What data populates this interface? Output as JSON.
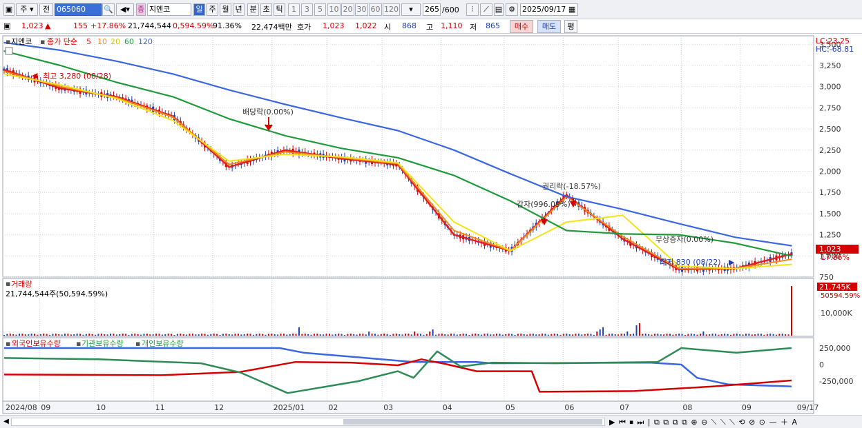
{
  "toolbar": {
    "type_select": "주",
    "prefix_select": "전",
    "code_value": "065060",
    "stock_name": "지엔코",
    "periods": [
      "일",
      "주",
      "월",
      "년",
      "분",
      "초",
      "틱"
    ],
    "active_period": "일",
    "intervals": [
      "1",
      "3",
      "5",
      "10",
      "20",
      "30",
      "60",
      "120"
    ],
    "count": "265",
    "count_total": "/600",
    "date": "2025/09/17"
  },
  "info": {
    "price": "1,023",
    "change": "155",
    "change_pct": "+17.86%",
    "volume": "21,744,544",
    "volume_pct": "0,594.59%",
    "turnover": "91.36%",
    "amount": "22,474백만",
    "ask_label": "호가",
    "ask": "1,023",
    "bid": "1,022",
    "open_label": "시",
    "open": "868",
    "high_label": "고",
    "high": "1,110",
    "low_label": "저",
    "low": "865",
    "buy_label": "매수",
    "sell_label": "매도",
    "eval_label": "평"
  },
  "legend": {
    "stock": "지엔코",
    "ma_label": "종가 단순",
    "ma_periods": [
      "5",
      "10",
      "20",
      "60",
      "120"
    ]
  },
  "price_axis": {
    "ticks": [
      "3,500",
      "3,250",
      "3,000",
      "2,750",
      "2,500",
      "2,250",
      "2,000",
      "1,750",
      "1,500",
      "1,250",
      "1,000",
      "750"
    ],
    "lc": "LC:23.25",
    "hc": "HC:-68.81",
    "current_price": "1,023",
    "current_pct": "17.86%"
  },
  "annotations": {
    "high_marker": "최고 3,280 (08/28)",
    "dividend": "배당락(0.00%)",
    "rights": "권리락(-18.57%)",
    "reduction": "감자(996.09%)",
    "bonus": "무상증자(0.00%)",
    "low_marker": "최저 830 (08/22)"
  },
  "volume_panel": {
    "title": "거래량",
    "value_text": "21,744,544주(50,594.59%)",
    "axis_tick": "10,000K",
    "current": "21,745K",
    "current_pct": "50594.59%"
  },
  "holdings_panel": {
    "foreign": "외국인보유수량",
    "institution": "기관보유수량",
    "individual": "개인보유수량",
    "ticks": [
      "250,000",
      "0",
      "-250,000"
    ]
  },
  "x_labels": [
    "2024/08",
    "09",
    "10",
    "11",
    "12",
    "2025/01",
    "02",
    "03",
    "04",
    "05",
    "06",
    "07",
    "08",
    "09",
    "09/17"
  ],
  "colors": {
    "up": "#d50000",
    "down": "#1a3fb8",
    "ma5": "#e02020",
    "ma10": "#f08a1c",
    "ma20": "#f2e418",
    "ma60": "#1f9a3a",
    "ma120": "#3a66e0",
    "foreign_line": "#3a66e0",
    "institution_line": "#d50000",
    "individual_line": "#2e8b57"
  },
  "chart_data": {
    "type": "line",
    "title": "지엔코",
    "x": [
      "2024/08",
      "09",
      "10",
      "11",
      "12",
      "2025/01",
      "02",
      "03",
      "04",
      "05",
      "06",
      "07",
      "08",
      "09",
      "09/17"
    ],
    "series": [
      {
        "name": "5",
        "values": [
          3200,
          2980,
          2880,
          2650,
          2050,
          2250,
          2150,
          2080,
          1250,
          1060,
          1720,
          1200,
          840,
          850,
          1023
        ]
      },
      {
        "name": "10",
        "values": [
          3180,
          3000,
          2870,
          2640,
          2080,
          2230,
          2160,
          2090,
          1300,
          1060,
          1700,
          1230,
          850,
          850,
          960
        ]
      },
      {
        "name": "20",
        "values": [
          3150,
          3020,
          2860,
          2600,
          2120,
          2200,
          2170,
          2100,
          1400,
          1060,
          1400,
          1480,
          880,
          850,
          900
        ]
      },
      {
        "name": "60",
        "values": [
          3420,
          3250,
          3050,
          2880,
          2620,
          2420,
          2270,
          2160,
          1950,
          1650,
          1300,
          1260,
          1250,
          1150,
          1000
        ]
      },
      {
        "name": "120",
        "values": [
          3520,
          3430,
          3300,
          3150,
          2960,
          2790,
          2630,
          2480,
          2250,
          1970,
          1700,
          1550,
          1380,
          1220,
          1120
        ]
      }
    ],
    "ylim": [
      750,
      3600
    ],
    "annotations": [
      "최고 3,280 (08/28)",
      "최저 830 (08/22)"
    ]
  }
}
